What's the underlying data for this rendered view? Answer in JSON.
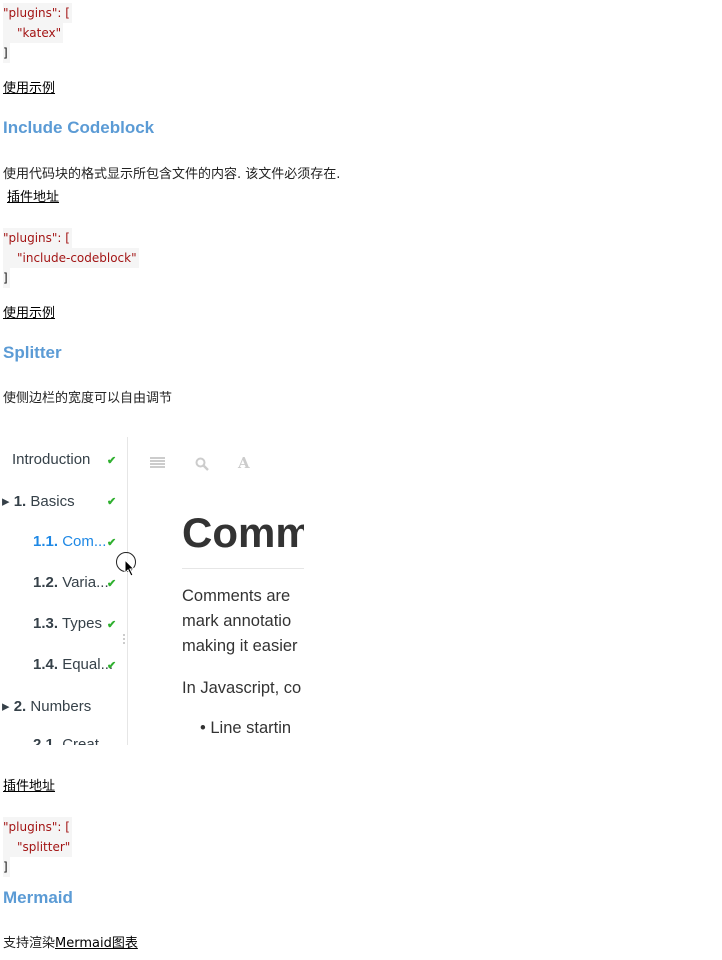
{
  "katex_code": {
    "open": "\"plugins\": [",
    "item": "\"katex\"",
    "close": "]"
  },
  "katex_example_link": "使用示例",
  "include_codeblock": {
    "heading": "Include Codeblock",
    "description": "使用代码块的格式显示所包含文件的内容. 该文件必须存在.",
    "plugin_link": "插件地址",
    "code": {
      "open": "\"plugins\": [",
      "item": "\"include-codeblock\"",
      "close": "]"
    },
    "example_link": "使用示例"
  },
  "splitter": {
    "heading": "Splitter",
    "description": "使侧边栏的宽度可以自由调节",
    "demo": {
      "sidebar": [
        {
          "num": "",
          "label": "Introduction",
          "done": true
        },
        {
          "num": "1.",
          "label": "Basics",
          "done": true
        },
        {
          "num": "1.1.",
          "label": "Com...",
          "done": true,
          "active": true
        },
        {
          "num": "1.2.",
          "label": "Varia...",
          "done": true
        },
        {
          "num": "1.3.",
          "label": "Types",
          "done": true
        },
        {
          "num": "1.4.",
          "label": "Equal...",
          "done": true
        },
        {
          "num": "2.",
          "label": "Numbers",
          "done": false
        },
        {
          "num": "2.1.",
          "label": "Creat",
          "done": false
        }
      ],
      "title": "Comm",
      "paragraph": [
        "Comments are",
        "mark annotatio",
        "making it easier"
      ],
      "paragraph2": "In Javascript, co",
      "bullet": "Line startin",
      "check": "✔"
    },
    "plugin_link": "插件地址",
    "code": {
      "open": "\"plugins\": [",
      "item": "\"splitter\"",
      "close": "]"
    }
  },
  "mermaid": {
    "heading": "Mermaid",
    "description_prefix": "支持渲染",
    "description_link": "Mermaid图表"
  },
  "colors": {
    "heading": "#5b9bd5",
    "active": "#1e88e5",
    "check": "#2fb02f",
    "string": "#a31515"
  }
}
